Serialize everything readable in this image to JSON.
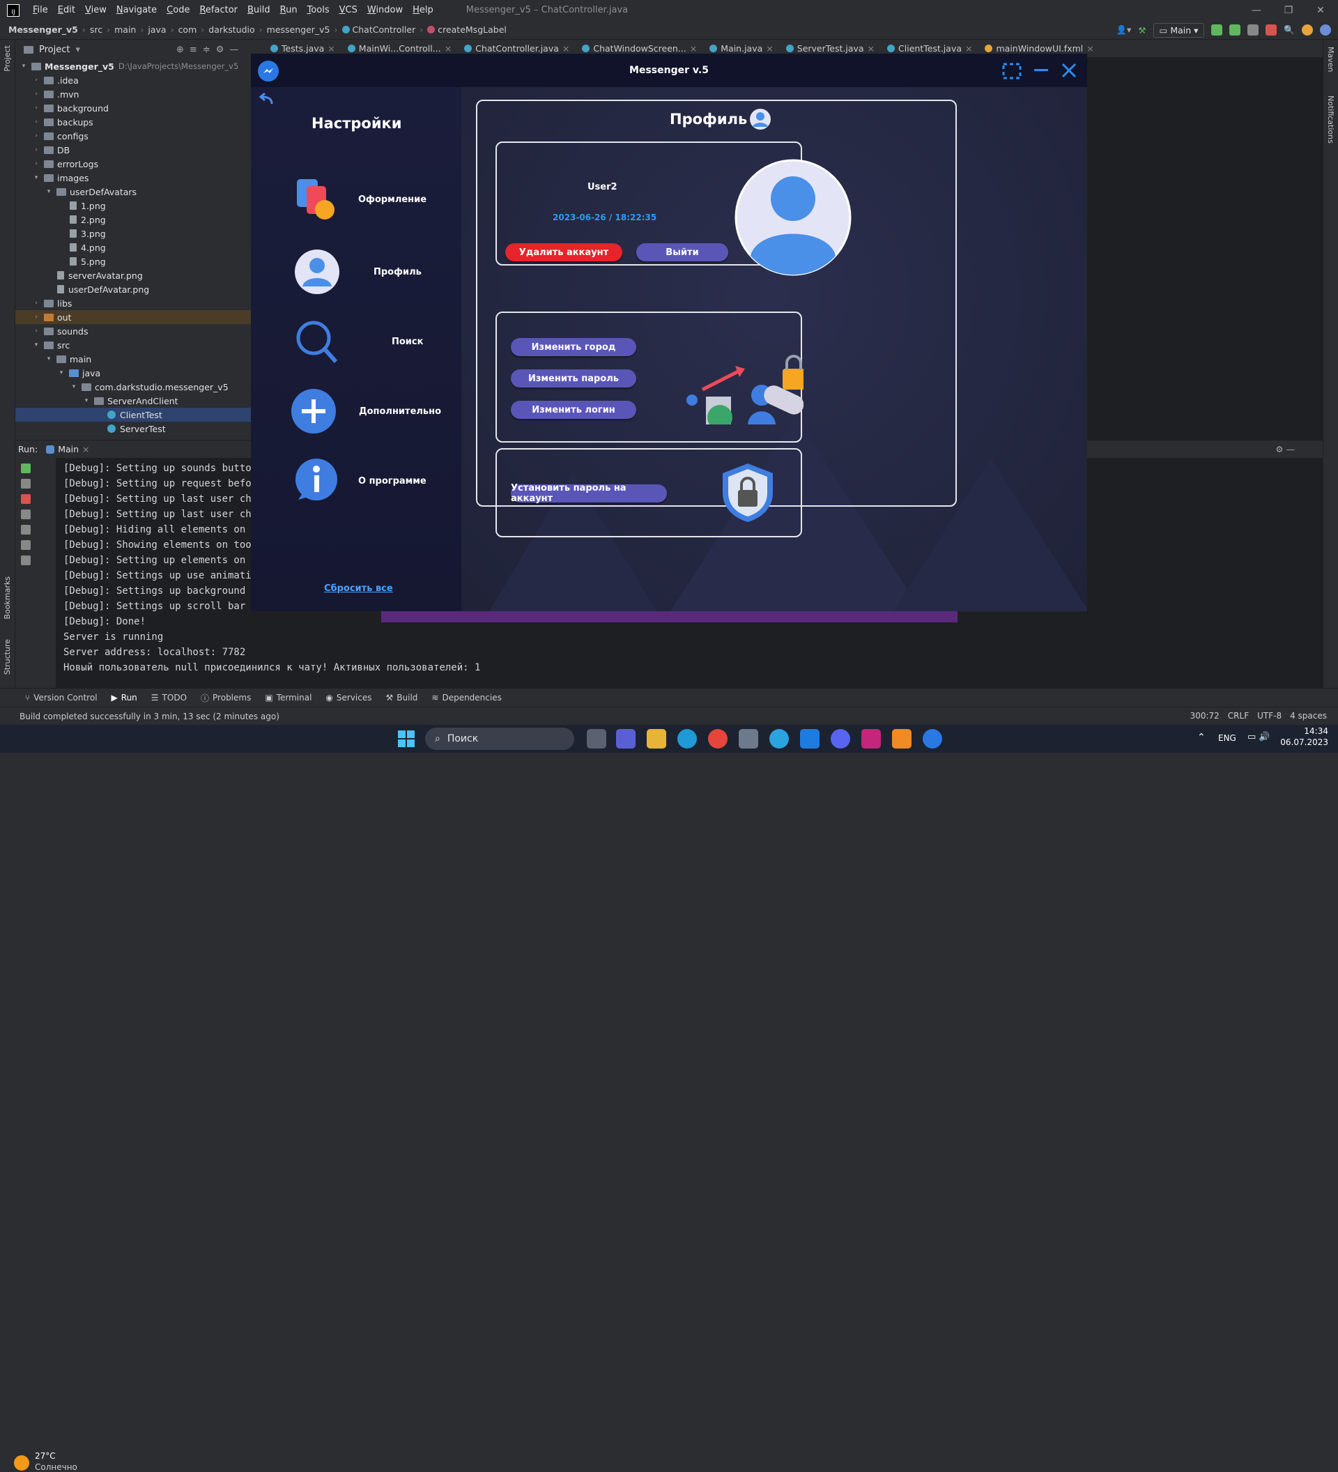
{
  "ide": {
    "menu": [
      "File",
      "Edit",
      "View",
      "Navigate",
      "Code",
      "Refactor",
      "Build",
      "Run",
      "Tools",
      "VCS",
      "Window",
      "Help"
    ],
    "window_title": "Messenger_v5 – ChatController.java",
    "breadcrumb": [
      "Messenger_v5",
      "src",
      "main",
      "java",
      "com",
      "darkstudio",
      "messenger_v5",
      "ChatController",
      "createMsgLabel"
    ],
    "run_config": "Main",
    "project_label": "Project",
    "tree": [
      {
        "label": "Messenger_v5",
        "extra": "D:\\JavaProjects\\Messenger_v5",
        "depth": 0,
        "kind": "folder",
        "open": true
      },
      {
        "label": ".idea",
        "depth": 1,
        "kind": "folder"
      },
      {
        "label": ".mvn",
        "depth": 1,
        "kind": "folder"
      },
      {
        "label": "background",
        "depth": 1,
        "kind": "folder"
      },
      {
        "label": "backups",
        "depth": 1,
        "kind": "folder"
      },
      {
        "label": "configs",
        "depth": 1,
        "kind": "folder"
      },
      {
        "label": "DB",
        "depth": 1,
        "kind": "folder"
      },
      {
        "label": "errorLogs",
        "depth": 1,
        "kind": "folder"
      },
      {
        "label": "images",
        "depth": 1,
        "kind": "folder",
        "open": true
      },
      {
        "label": "userDefAvatars",
        "depth": 2,
        "kind": "folder",
        "open": true
      },
      {
        "label": "1.png",
        "depth": 3,
        "kind": "file"
      },
      {
        "label": "2.png",
        "depth": 3,
        "kind": "file"
      },
      {
        "label": "3.png",
        "depth": 3,
        "kind": "file"
      },
      {
        "label": "4.png",
        "depth": 3,
        "kind": "file"
      },
      {
        "label": "5.png",
        "depth": 3,
        "kind": "file"
      },
      {
        "label": "serverAvatar.png",
        "depth": 2,
        "kind": "file"
      },
      {
        "label": "userDefAvatar.png",
        "depth": 2,
        "kind": "file"
      },
      {
        "label": "libs",
        "depth": 1,
        "kind": "folder"
      },
      {
        "label": "out",
        "depth": 1,
        "kind": "folder",
        "style": "out"
      },
      {
        "label": "sounds",
        "depth": 1,
        "kind": "folder"
      },
      {
        "label": "src",
        "depth": 1,
        "kind": "folder",
        "open": true
      },
      {
        "label": "main",
        "depth": 2,
        "kind": "folder",
        "open": true
      },
      {
        "label": "java",
        "depth": 3,
        "kind": "folder",
        "open": true,
        "style": "blue"
      },
      {
        "label": "com.darkstudio.messenger_v5",
        "depth": 4,
        "kind": "folder",
        "open": true
      },
      {
        "label": "ServerAndClient",
        "depth": 5,
        "kind": "folder",
        "open": true
      },
      {
        "label": "ClientTest",
        "depth": 6,
        "kind": "class",
        "style": "sel"
      },
      {
        "label": "ServerTest",
        "depth": 6,
        "kind": "class"
      }
    ],
    "tabs": [
      "Tests.java",
      "MainWi...Controll...",
      "ChatController.java",
      "ChatWindowScreen...",
      "Main.java",
      "ServerTest.java",
      "ClientTest.java",
      "mainWindowUI.fxml"
    ],
    "run_label": "Run:",
    "run_tab": "Main",
    "console": [
      "[Debug]: Setting up sounds button",
      "[Debug]: Setting up request before",
      "[Debug]: Setting up last user chat",
      "[Debug]: Setting up last user chat",
      "[Debug]: Hiding all elements on to",
      "[Debug]: Showing elements on tool",
      "[Debug]: Setting up elements on to",
      "[Debug]: Settings up use animatio",
      "[Debug]: Settings up background",
      "[Debug]: Settings up scroll bar po",
      "[Debug]: Done!",
      "Server is running",
      "Server address: localhost: 7782",
      "Новый пользователь null присоединился к чату! Активных пользователей: 1"
    ],
    "tool_windows": [
      "Version Control",
      "Run",
      "TODO",
      "Problems",
      "Terminal",
      "Services",
      "Build",
      "Dependencies"
    ],
    "status_message": "Build completed successfully in 3 min, 13 sec (2 minutes ago)",
    "status_right": [
      "300:72",
      "CRLF",
      "UTF-8",
      "4 spaces"
    ],
    "left_strip": [
      "Project",
      "Bookmarks",
      "Structure"
    ],
    "right_strip": [
      "Maven",
      "Notifications"
    ]
  },
  "messenger": {
    "title": "Messenger v.5",
    "sidebar_title": "Настройки",
    "menu": [
      {
        "label": "Оформление",
        "icon": "palette-icon"
      },
      {
        "label": "Профиль",
        "icon": "profile-icon"
      },
      {
        "label": "Поиск",
        "icon": "search-icon"
      },
      {
        "label": "Дополнительно",
        "icon": "plus-icon"
      },
      {
        "label": "О программе",
        "icon": "info-icon"
      }
    ],
    "reset_link": "Сбросить все",
    "profile_title": "Профиль",
    "username": "User2",
    "reg_date": "2023-06-26 / 18:22:35",
    "delete_btn": "Удалить аккаунт",
    "logout_btn": "Выйти",
    "change_city": "Изменить город",
    "change_password": "Изменить пароль",
    "change_login": "Изменить логин",
    "set_password": "Установить пароль на аккаунт"
  },
  "taskbar": {
    "weather_temp": "27°C",
    "weather_text": "Солнечно",
    "search_placeholder": "Поиск",
    "lang": "ENG",
    "time": "14:34",
    "date": "06.07.2023"
  }
}
